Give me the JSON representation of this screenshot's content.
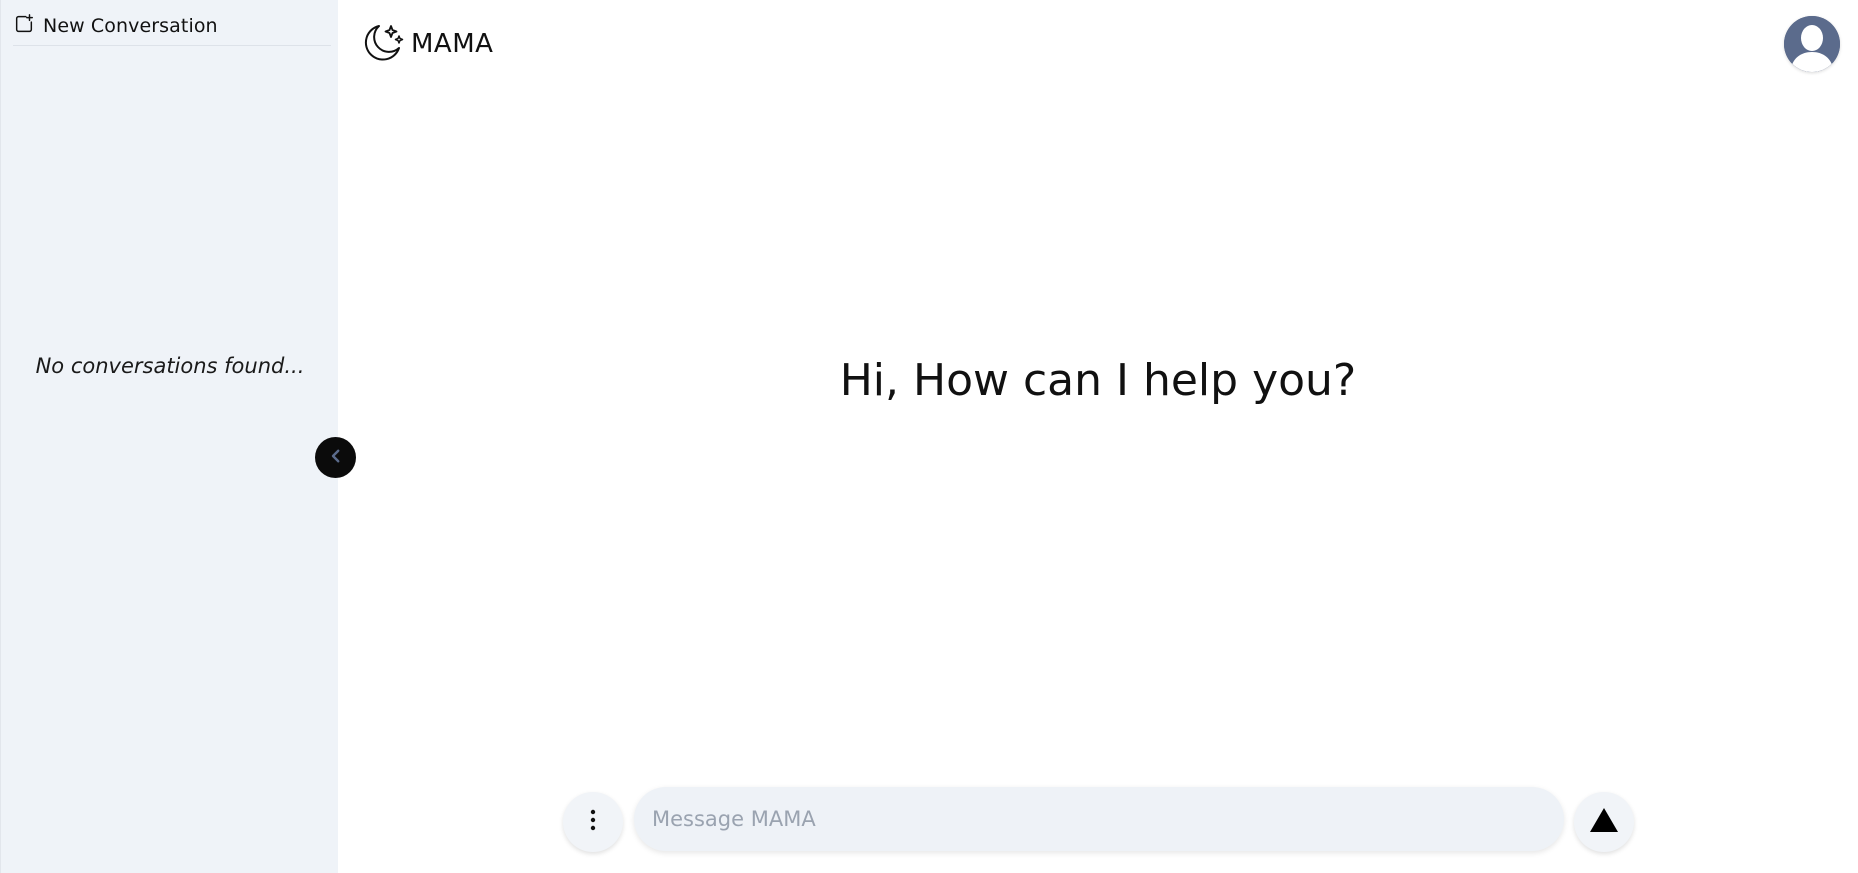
{
  "sidebar": {
    "new_conversation_label": "New Conversation",
    "empty_state": "No conversations found..."
  },
  "header": {
    "brand_name": "MAMA"
  },
  "main": {
    "greeting": "Hi, How can I help you?"
  },
  "composer": {
    "placeholder": "Message MAMA",
    "value": ""
  },
  "icons": {
    "new_conversation": "new-conversation-icon",
    "collapse": "chevron-left-icon",
    "brand": "moon-sparkle-icon",
    "avatar": "user-avatar-icon",
    "menu": "vertical-dots-icon",
    "send": "triangle-up-icon"
  },
  "colors": {
    "sidebar_bg": "#eff3f8",
    "collapse_button": "#0b0b0b",
    "avatar_bg": "#5b6b8c",
    "input_bg": "#eef2f7"
  }
}
